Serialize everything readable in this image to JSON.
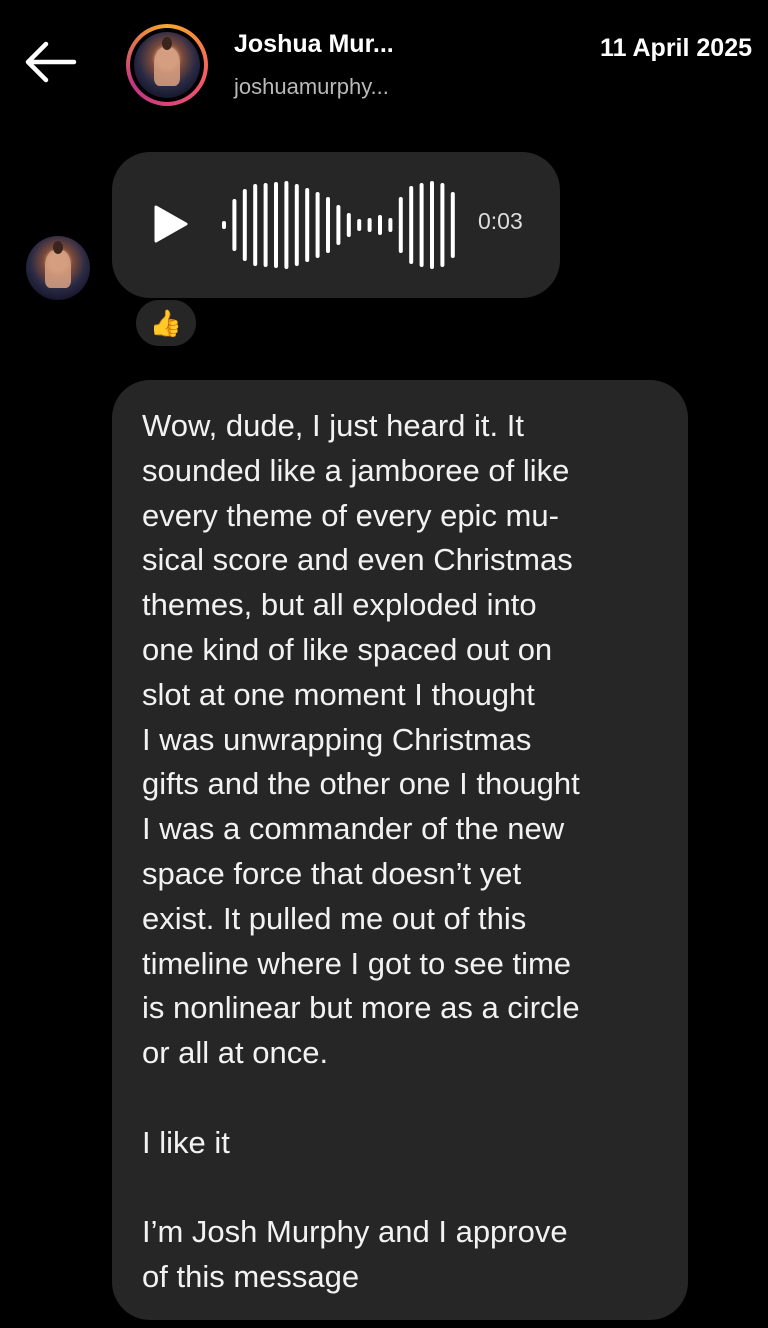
{
  "header": {
    "contact_name": "Joshua Mur...",
    "contact_handle": "joshuamurphy...",
    "date": "11 April 2025"
  },
  "voice_message": {
    "duration": "0:03"
  },
  "reaction": {
    "emoji": "👍"
  },
  "text_message": {
    "paragraphs": [
      "Wow, dude, I just heard it. It\nsounded like a jamboree of like\nevery theme of every epic mu-\nsical score and even Christmas\nthemes, but all exploded into\none kind of like spaced out on\nslot at one moment I thought\nI was unwrapping Christmas\ngifts and the other one I thought\nI was a commander of the new\nspace force that doesn’t yet\nexist. It pulled me out of this\ntimeline where I got to see time\nis nonlinear but more as a circle\nor all at once.",
      "I like it",
      "I’m Josh Murphy and I approve\nof this message"
    ]
  },
  "icons": {
    "back": "arrow-left-icon",
    "play": "play-icon",
    "waveform": "waveform-icon"
  }
}
